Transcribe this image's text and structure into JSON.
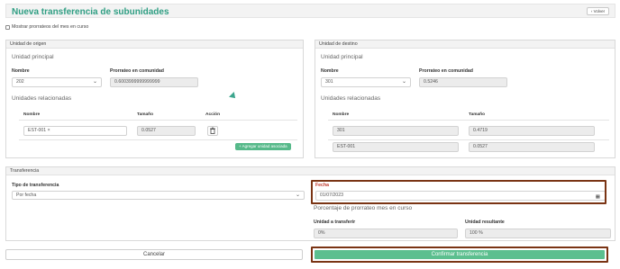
{
  "header": {
    "title": "Nueva transferencia de subunidades",
    "back_label": "Volver"
  },
  "show_prorrateos": {
    "label": "Mostrar prorrateos del mes en curso",
    "checked": false
  },
  "origen": {
    "title": "Unidad de origen",
    "subtitle": "Unidad principal",
    "nombre_label": "Nombre",
    "nombre_value": "202",
    "prorrateo_label": "Prorrateo en comunidad",
    "prorrateo_value": "0.6003999999999999",
    "relacionadas_label": "Unidades relacionadas",
    "columns": {
      "nombre": "Nombre",
      "tamano": "Tamaño",
      "accion": "Acción"
    },
    "rows": [
      {
        "nombre": "EST-001 ×",
        "tamano": "0.0527"
      }
    ],
    "add_label": "+ Agregar unidad asociada"
  },
  "destino": {
    "title": "Unidad de destino",
    "subtitle": "Unidad principal",
    "nombre_label": "Nombre",
    "nombre_value": "301",
    "prorrateo_label": "Prorrateo en comunidad",
    "prorrateo_value": "0.5246",
    "relacionadas_label": "Unidades relacionadas",
    "columns": {
      "nombre": "Nombre",
      "tamano": "Tamaño"
    },
    "rows": [
      {
        "nombre": "301",
        "tamano": "0.4719"
      },
      {
        "nombre": "EST-001",
        "tamano": "0.0527"
      }
    ]
  },
  "transferencia": {
    "title": "Transferencia",
    "tipo_label": "Tipo de transferencia",
    "tipo_value": "Por fecha",
    "fecha_label": "Fecha",
    "fecha_value": "01/07/2023",
    "porcentaje_label": "Porcentaje de prorrateo mes en curso",
    "unidad_transferir_label": "Unidad a transferir",
    "unidad_transferir_value": "0%",
    "unidad_resultante_label": "Unidad resultante",
    "unidad_resultante_value": "100 %"
  },
  "actions": {
    "cancel_label": "Cancelar",
    "confirm_label": "Confirmar transferencia"
  },
  "colors": {
    "accent": "#2f9e83",
    "button_green": "#5cbf8f",
    "highlight": "#7a3414"
  }
}
